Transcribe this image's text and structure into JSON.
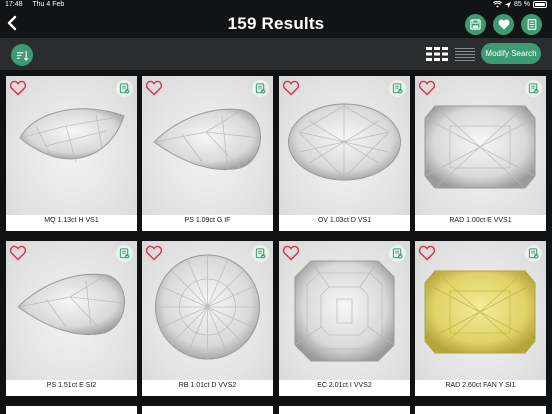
{
  "status": {
    "time": "17:48",
    "date": "Thu 4 Feb",
    "battery": "85 %",
    "battery_level": 0.85
  },
  "header": {
    "title": "159 Results",
    "back_icon": "chevron-left-icon",
    "actions": [
      {
        "name": "save-search-button",
        "icon": "floppy-disk-icon"
      },
      {
        "name": "favorites-button",
        "icon": "heart-icon"
      },
      {
        "name": "list-button",
        "icon": "document-list-icon"
      }
    ]
  },
  "toolbar": {
    "sort_icon": "sort-icon",
    "grid_view_icon": "grid-view-icon",
    "list_view_icon": "list-view-icon",
    "modify_label": "Modify Search"
  },
  "colors": {
    "accent": "#3d9b74",
    "heart": "#d9334f",
    "background": "#111213",
    "toolbar": "#2a2c2e"
  },
  "results": [
    {
      "caption": "MQ 1.13ct H VS1",
      "shape": "marquise",
      "tint": "white"
    },
    {
      "caption": "PS 1.09ct G IF",
      "shape": "pear",
      "tint": "white"
    },
    {
      "caption": "OV 1.03ct D VS1",
      "shape": "oval",
      "tint": "white"
    },
    {
      "caption": "RAD 1.00ct E VVS1",
      "shape": "radiant",
      "tint": "white"
    },
    {
      "caption": "PS 1.51ct E SI2",
      "shape": "pear",
      "tint": "white"
    },
    {
      "caption": "RB 1.01ct D VVS2",
      "shape": "round",
      "tint": "white"
    },
    {
      "caption": "EC 2.01ct I VVS2",
      "shape": "emerald",
      "tint": "white"
    },
    {
      "caption": "RAD 2.60ct FAN Y SI1",
      "shape": "radiant",
      "tint": "yellow"
    }
  ]
}
